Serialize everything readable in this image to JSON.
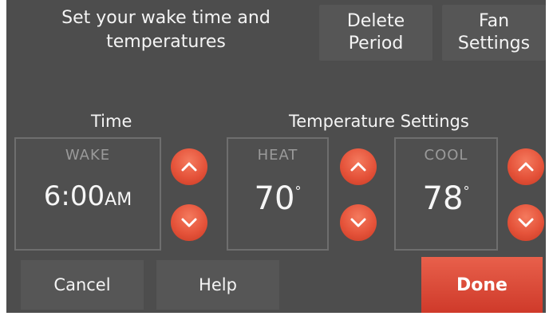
{
  "header": {
    "prompt_line1": "Set your wake time and",
    "prompt_line2": "temperatures",
    "delete_line1": "Delete",
    "delete_line2": "Period",
    "fan_line1": "Fan",
    "fan_line2": "Settings"
  },
  "sections": {
    "time_heading": "Time",
    "temperature_heading": "Temperature Settings"
  },
  "wake": {
    "label": "WAKE",
    "time": "6:00",
    "ampm": "AM"
  },
  "heat": {
    "label": "HEAT",
    "value": "70",
    "degree": "°"
  },
  "cool": {
    "label": "COOL",
    "value": "78",
    "degree": "°"
  },
  "footer": {
    "cancel_label": "Cancel",
    "help_label": "Help",
    "done_label": "Done"
  },
  "colors": {
    "screen_bg": "#4d4d4d",
    "button_bg": "#565656",
    "accent": "#e5533a",
    "label_gray": "#9a9a9a"
  },
  "icons": [
    "chevron-up-icon",
    "chevron-down-icon"
  ]
}
